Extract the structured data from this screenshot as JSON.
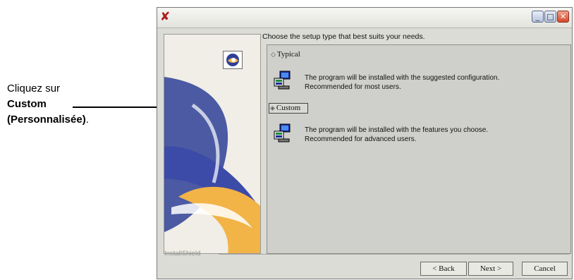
{
  "callout": {
    "line1": "Cliquez sur",
    "line2": "Custom",
    "line3_bold": "(Personnalisée)",
    "line3_end": "."
  },
  "window": {
    "title": "",
    "instruction": "Choose the setup type that best suits your needs.",
    "options": [
      {
        "label": "Typical",
        "description_line1": "The program will be installed with the suggested configuration.",
        "description_line2": "Recommended for most users."
      },
      {
        "label": "Custom",
        "description_line1": "The program will be installed with the features you choose.",
        "description_line2": "Recommended for advanced users."
      }
    ],
    "brand": "InstallShield",
    "buttons": {
      "back": "< Back",
      "next": "Next >",
      "cancel": "Cancel"
    }
  },
  "icons": [
    "app-installer-icon",
    "minimize-icon",
    "maximize-icon",
    "close-icon",
    "installshield-logo-icon",
    "computer-setup-icon"
  ],
  "colors": {
    "window_bg": "#dcdcd6",
    "panel_bg": "#cfcfcb",
    "banner_blue": "#2e3f97",
    "banner_orange": "#f2b347",
    "close_button": "#d8462a"
  }
}
